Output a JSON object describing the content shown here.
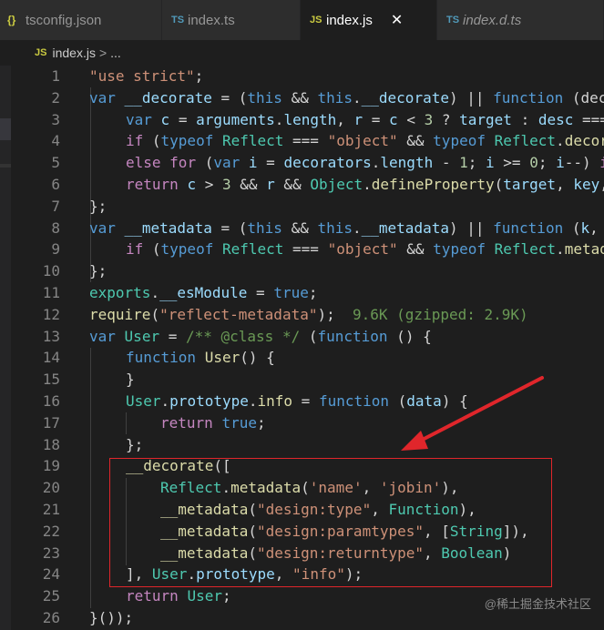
{
  "tabs": [
    {
      "icon": "{}",
      "label": "tsconfig.json"
    },
    {
      "icon": "TS",
      "label": "index.ts"
    },
    {
      "icon": "JS",
      "label": "index.js",
      "close": "✕"
    },
    {
      "icon": "TS",
      "label": "index.d.ts"
    }
  ],
  "breadcrumb": {
    "icon": "JS",
    "file": "index.js",
    "separator": ">",
    "more": "..."
  },
  "lines": [
    {
      "n": "1"
    },
    {
      "n": "2"
    },
    {
      "n": "3"
    },
    {
      "n": "4"
    },
    {
      "n": "5"
    },
    {
      "n": "6"
    },
    {
      "n": "7"
    },
    {
      "n": "8"
    },
    {
      "n": "9"
    },
    {
      "n": "10"
    },
    {
      "n": "11"
    },
    {
      "n": "12"
    },
    {
      "n": "13"
    },
    {
      "n": "14"
    },
    {
      "n": "15"
    },
    {
      "n": "16"
    },
    {
      "n": "17"
    },
    {
      "n": "18"
    },
    {
      "n": "19"
    },
    {
      "n": "20"
    },
    {
      "n": "21"
    },
    {
      "n": "22"
    },
    {
      "n": "23"
    },
    {
      "n": "24"
    },
    {
      "n": "25"
    },
    {
      "n": "26"
    }
  ],
  "code": {
    "l1": [
      "\"use strict\"",
      ";"
    ],
    "l2": [
      "var",
      "__decorate",
      " = (",
      "this",
      " && ",
      "this",
      ".",
      "__decorate",
      ") || ",
      "function",
      " (dec"
    ],
    "l3": [
      "var",
      "c",
      " = ",
      "arguments",
      ".",
      "length",
      ", ",
      "r",
      " = ",
      "c",
      " < ",
      "3",
      " ? ",
      "target",
      " : ",
      "desc",
      " ==="
    ],
    "l4": [
      "if",
      " (",
      "typeof",
      " ",
      "Reflect",
      " === ",
      "\"object\"",
      " && ",
      "typeof",
      " ",
      "Reflect",
      ".",
      "decor"
    ],
    "l5": [
      "else",
      " ",
      "for",
      " (",
      "var",
      " ",
      "i",
      " = ",
      "decorators",
      ".",
      "length",
      " - ",
      "1",
      "; ",
      "i",
      " >= ",
      "0",
      "; ",
      "i",
      "--) ",
      "i"
    ],
    "l6": [
      "return",
      " ",
      "c",
      " > ",
      "3",
      " && ",
      "r",
      " && ",
      "Object",
      ".",
      "defineProperty",
      "(",
      "target",
      ", ",
      "key",
      ","
    ],
    "l7": [
      "};"
    ],
    "l8": [
      "var",
      "__metadata",
      " = (",
      "this",
      " && ",
      "this",
      ".",
      "__metadata",
      ") || ",
      "function",
      " (",
      "k",
      ","
    ],
    "l9": [
      "if",
      " (",
      "typeof",
      " ",
      "Reflect",
      " === ",
      "\"object\"",
      " && ",
      "typeof",
      " ",
      "Reflect",
      ".",
      "metad"
    ],
    "l10": [
      "};"
    ],
    "l11": [
      "exports",
      ".",
      "__esModule",
      " = ",
      "true",
      ";"
    ],
    "l12": [
      "require",
      "(",
      "\"reflect-metadata\"",
      ");",
      "  9.6K (gzipped: 2.9K)"
    ],
    "l13": [
      "var",
      "User",
      " = ",
      "/** @class */",
      " (",
      "function",
      " () {"
    ],
    "l14": [
      "function",
      " ",
      "User",
      "() {"
    ],
    "l15": [
      "}"
    ],
    "l16": [
      "User",
      ".",
      "prototype",
      ".",
      "info",
      " = ",
      "function",
      " (",
      "data",
      ") {"
    ],
    "l17": [
      "return",
      " ",
      "true",
      ";"
    ],
    "l18": [
      "};"
    ],
    "l19": [
      "__decorate",
      "(["
    ],
    "l20": [
      "Reflect",
      ".",
      "metadata",
      "(",
      "'name'",
      ", ",
      "'jobin'",
      "),"
    ],
    "l21": [
      "__metadata",
      "(",
      "\"design:type\"",
      ", ",
      "Function",
      "),"
    ],
    "l22": [
      "__metadata",
      "(",
      "\"design:paramtypes\"",
      ", [",
      "String",
      "]),"
    ],
    "l23": [
      "__metadata",
      "(",
      "\"design:returntype\"",
      ", ",
      "Boolean",
      ")"
    ],
    "l24": [
      "], ",
      "User",
      ".",
      "prototype",
      ", ",
      "\"info\"",
      ");"
    ],
    "l25": [
      "return",
      " ",
      "User",
      ";"
    ],
    "l26": [
      "}());"
    ]
  },
  "watermark": "@稀土掘金技术社区",
  "colors": {
    "highlight_box": "#e0262b",
    "arrow": "#e0262b"
  }
}
